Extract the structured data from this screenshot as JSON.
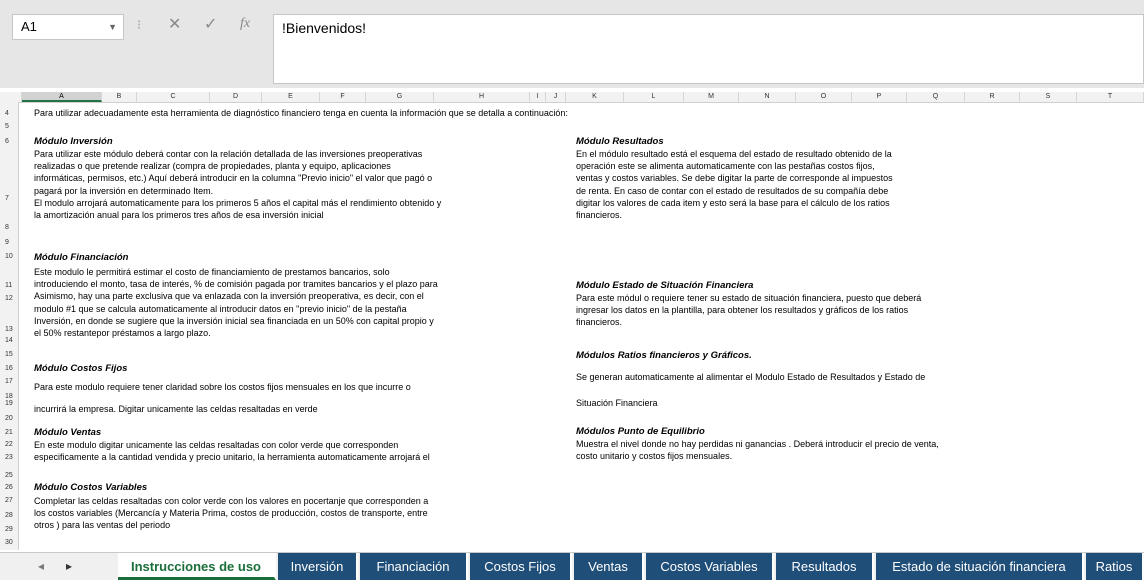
{
  "formula_bar": {
    "name_box": "A1",
    "cancel_icon": "✕",
    "enter_icon": "✓",
    "fx_icon": "fx",
    "content": "!Bienvenidos!"
  },
  "columns": [
    "A",
    "B",
    "C",
    "D",
    "E",
    "F",
    "G",
    "H",
    "I",
    "J",
    "K",
    "L",
    "M",
    "N",
    "O",
    "P",
    "Q",
    "R",
    "S",
    "T"
  ],
  "rows": [
    "4",
    "5",
    "6",
    "7",
    "8",
    "9",
    "10",
    "11",
    "12",
    "13",
    "14",
    "15",
    "16",
    "17",
    "18",
    "19",
    "20",
    "21",
    "22",
    "23",
    "25",
    "26",
    "27",
    "28",
    "29",
    "30"
  ],
  "intro": "Para utilizar adecuadamente esta herramienta de diagnóstico financiero tenga en cuenta la información que se detalla a continuación:",
  "left": {
    "inversion": {
      "title": "Módulo Inversión",
      "lines": [
        "Para utilizar este módulo deberá contar con la relación detallada de las inversiones preoperativas",
        "realizadas o que pretende realizar (compra de propiedades, planta y equipo, aplicaciones",
        "informáticas, permisos, etc.) Aquí deberá introducir en la columna \"Previo inicio\" el valor que pagó o",
        "pagará por la inversión en determinado Item.",
        "El modulo arrojará automaticamente para los primeros 5 años el capital más el rendimiento obtenido y",
        "la amortización anual para los primeros tres años de esa inversión inicial"
      ]
    },
    "financiacion": {
      "title": "Módulo Financiación",
      "lines": [
        "Este modulo le permitirá estimar el costo de financiamiento de prestamos bancarios, solo",
        "introduciendo el monto, tasa de interés, % de comisión pagada por tramites bancarios y el plazo para",
        "Asimismo, hay una parte exclusiva que va enlazada con la inversión preoperativa, es decir, con el",
        "modulo #1 que se calcula automaticamente al introducir datos en \"previo inicio\" de la pestaña",
        "Inversión, en donde se sugiere que la inversión inicial sea financiada en un 50% con capital propio y",
        "el 50% restantepor préstamos a largo plazo."
      ]
    },
    "costos_fijos": {
      "title": "Módulo Costos Fijos",
      "lines": [
        "Para este modulo requiere tener claridad sobre los costos fijos mensuales en los que incurre o",
        "incurrirá la empresa. Digitar unicamente las celdas resaltadas en verde"
      ]
    },
    "ventas": {
      "title": "Módulo Ventas",
      "lines": [
        "En este modulo digitar unicamente las celdas resaltadas con color verde que corresponden",
        "especificamente a la cantidad vendida y precio unitario, la herramienta automaticamente arrojará el"
      ]
    },
    "costos_variables": {
      "title": "Módulo Costos Variables",
      "lines": [
        "Completar las celdas resaltadas con color verde con los valores en pocertanje que corresponden a",
        "los costos variables (Mercancía y Materia Prima, costos de producción, costos de transporte, entre",
        "otros ) para las ventas del periodo"
      ]
    }
  },
  "right": {
    "resultados": {
      "title": "Módulo Resultados",
      "lines": [
        "En el módulo resultado está el esquema del estado de resultado obtenido de la",
        "operación este se alimenta automaticamente con las pestañas costos fijos,",
        "ventas y costos variables. Se debe digitar la parte de corresponde al impuestos",
        "de renta. En caso de contar con el estado de resultados de su compañía debe",
        "digitar los valores de cada item y esto será la base para el cálculo de los ratios",
        "financieros."
      ]
    },
    "estado_situacion": {
      "title": "Módulo Estado de Situación Financiera",
      "lines": [
        "Para este módul o requiere tener su estado de situación financiera, puesto que deberá",
        "ingresar los datos en la plantilla, para obtener los resultados y gráficos de los ratios",
        "financieros."
      ]
    },
    "ratios": {
      "title": "Módulos Ratios financieros y Gráficos.",
      "lines": [
        "Se generan automaticamente al alimentar el Modulo Estado de Resultados y Estado de",
        "Situación Financiera"
      ]
    },
    "equilibrio": {
      "title": "Módulos Punto de Equilibrio",
      "lines": [
        "Muestra el nivel donde no hay perdidas ni ganancias . Deberá introducir el precio de venta,",
        "costo unitario y costos fijos mensuales."
      ]
    }
  },
  "tabs": [
    "Instrucciones de uso",
    "Inversión",
    "Financiación",
    "Costos Fijos",
    "Ventas",
    "Costos Variables",
    "Resultados",
    "Estado de situación financiera",
    "Ratios"
  ],
  "nav": {
    "prev": "◂",
    "next": "▸"
  }
}
